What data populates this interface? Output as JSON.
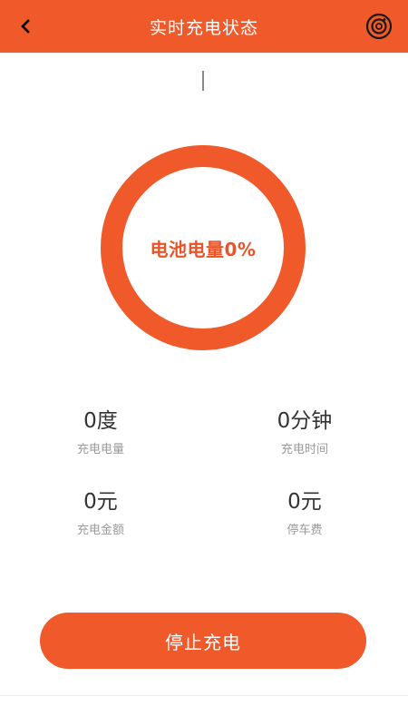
{
  "header": {
    "title": "实时充电状态",
    "back_icon": "chevron-left-icon",
    "settings_icon": "camera-lens-icon",
    "background": "#f0592a"
  },
  "battery": {
    "label": "电池电量0%",
    "percent": 0
  },
  "stats": [
    {
      "value": "0度",
      "label": "充电电量"
    },
    {
      "value": "0分钟",
      "label": "充电时间"
    },
    {
      "value": "0元",
      "label": "充电金额"
    },
    {
      "value": "0元",
      "label": "停车费"
    }
  ],
  "actions": {
    "stop_label": "停止充电"
  },
  "colors": {
    "accent": "#f0592a",
    "ring_text": "#e8552a"
  }
}
